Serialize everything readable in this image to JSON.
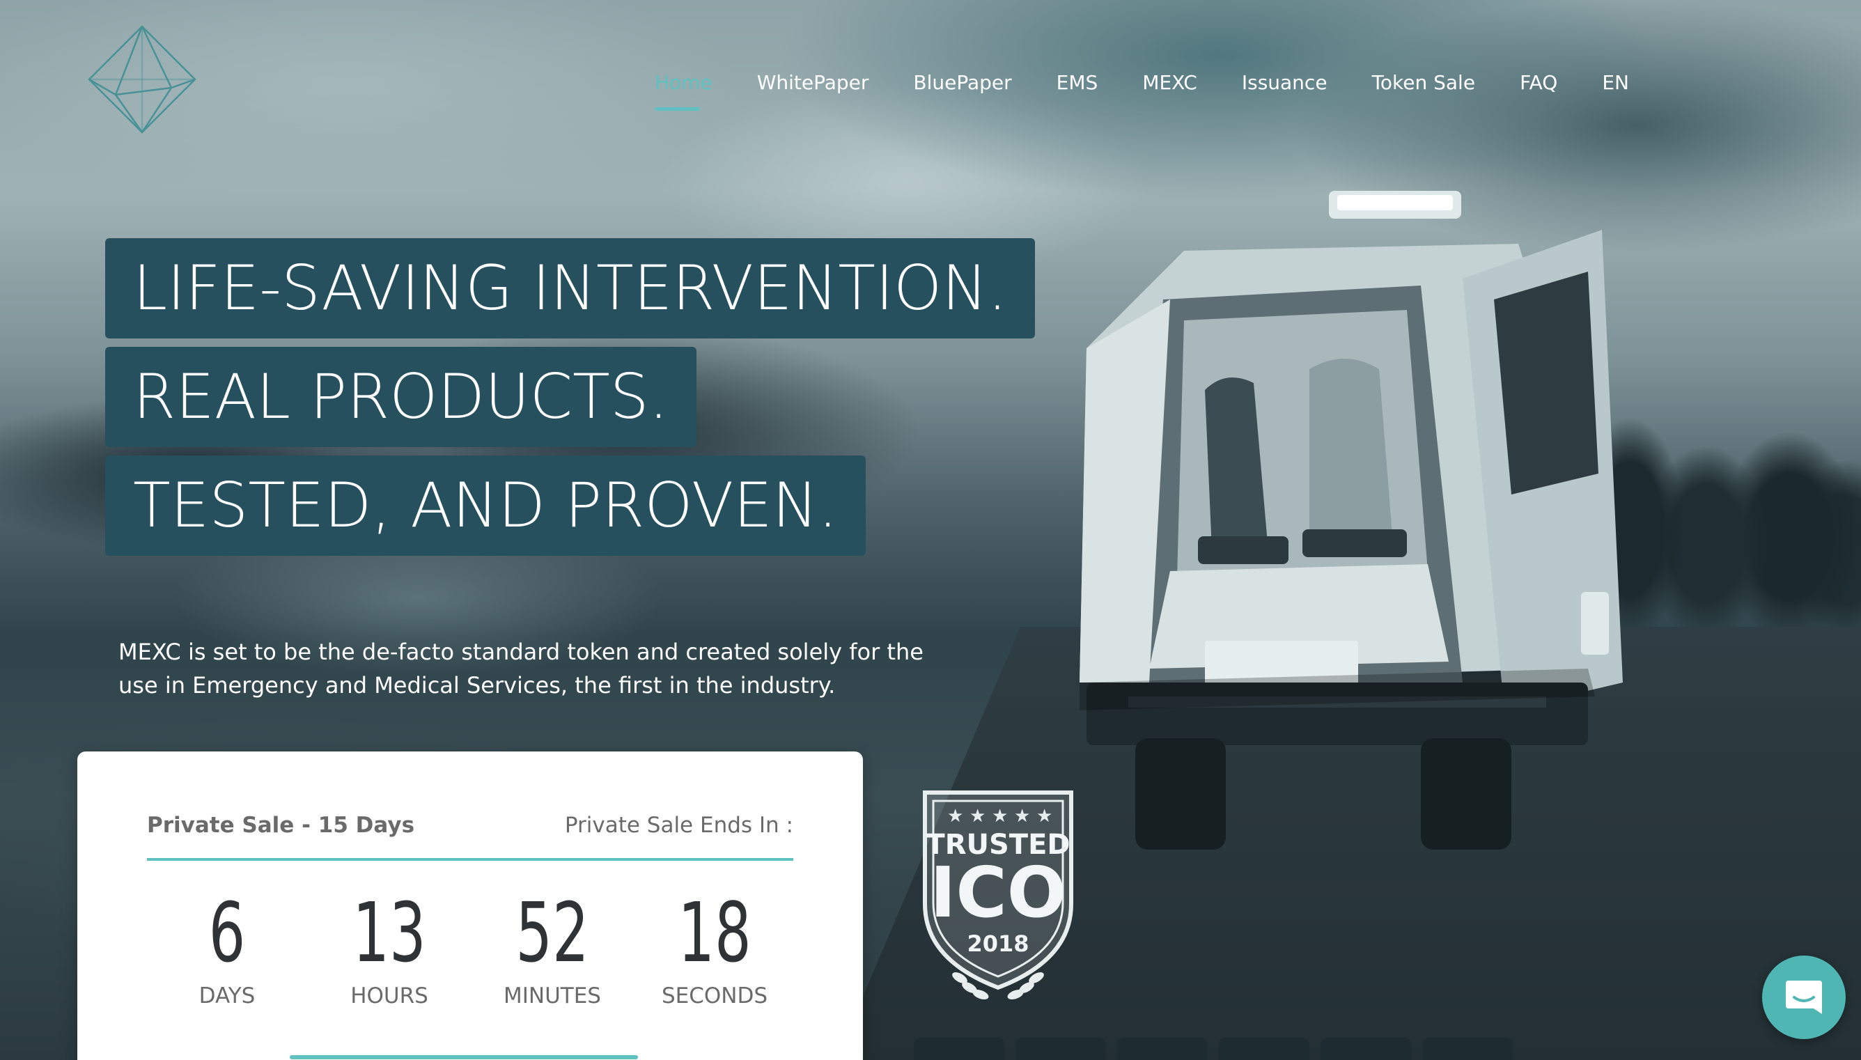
{
  "nav": {
    "items": [
      {
        "label": "Home",
        "active": true
      },
      {
        "label": "WhitePaper",
        "active": false
      },
      {
        "label": "BluePaper",
        "active": false
      },
      {
        "label": "EMS",
        "active": false
      },
      {
        "label": "MEXC",
        "active": false
      },
      {
        "label": "Issuance",
        "active": false
      },
      {
        "label": "Token Sale",
        "active": false
      },
      {
        "label": "FAQ",
        "active": false
      },
      {
        "label": "EN",
        "active": false
      }
    ],
    "active_color": "#5fc1c1"
  },
  "hero": {
    "lines": [
      "LIFE-SAVING INTERVENTION.",
      "REAL PRODUCTS.",
      "TESTED, AND PROVEN."
    ],
    "subtext": "MEXC is set to be the de-facto standard token and created solely for the use in Emergency and Medical Services, the first in the industry.",
    "headline_bg": "#27505e"
  },
  "countdown": {
    "title": "Private Sale - 15 Days",
    "ends_label": "Private Sale Ends In :",
    "units": [
      {
        "value": "6",
        "label": "DAYS"
      },
      {
        "value": "13",
        "label": "HOURS"
      },
      {
        "value": "52",
        "label": "MINUTES"
      },
      {
        "value": "18",
        "label": "SECONDS"
      }
    ],
    "accent": "#5fc1c1"
  },
  "badge": {
    "top": "TRUSTED",
    "main": "ICO",
    "year": "2018"
  },
  "icons": {
    "logo": "diamond-logo-icon",
    "chat": "chat-icon"
  }
}
